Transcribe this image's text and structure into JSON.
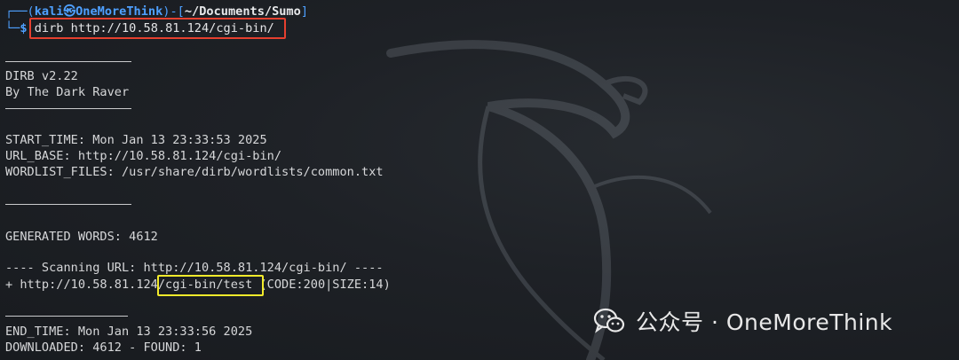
{
  "prompt": {
    "user_host": "kali㉿OneMoreThink",
    "path": "~/Documents/Sumo",
    "dollar": "$",
    "command": "dirb http://10.58.81.124/cgi-bin/"
  },
  "output": {
    "banner_title": "DIRB v2.22",
    "banner_author": "By The Dark Raver",
    "start_time": "START_TIME: Mon Jan 13 23:33:53 2025",
    "url_base": "URL_BASE: http://10.58.81.124/cgi-bin/",
    "wordlist": "WORDLIST_FILES: /usr/share/dirb/wordlists/common.txt",
    "generated_words": "GENERATED WORDS: 4612",
    "scanning": "---- Scanning URL: http://10.58.81.124/cgi-bin/ ----",
    "found_prefix": "+ http://10.58.81.124",
    "found_path": "/cgi-bin/test",
    "found_suffix": " (CODE:200|SIZE:14)",
    "end_time": "END_TIME: Mon Jan 13 23:33:56 2025",
    "downloaded": "DOWNLOADED: 4612 - FOUND: 1"
  },
  "watermark": {
    "text": "公众号 · OneMoreThink",
    "icon": "wechat-icon"
  },
  "colors": {
    "background": "#1b1e23",
    "prompt_blue": "#4ea0ff",
    "text": "#d6d7d9",
    "highlight_red": "#e5402f",
    "highlight_yellow": "#f2ea2b"
  }
}
